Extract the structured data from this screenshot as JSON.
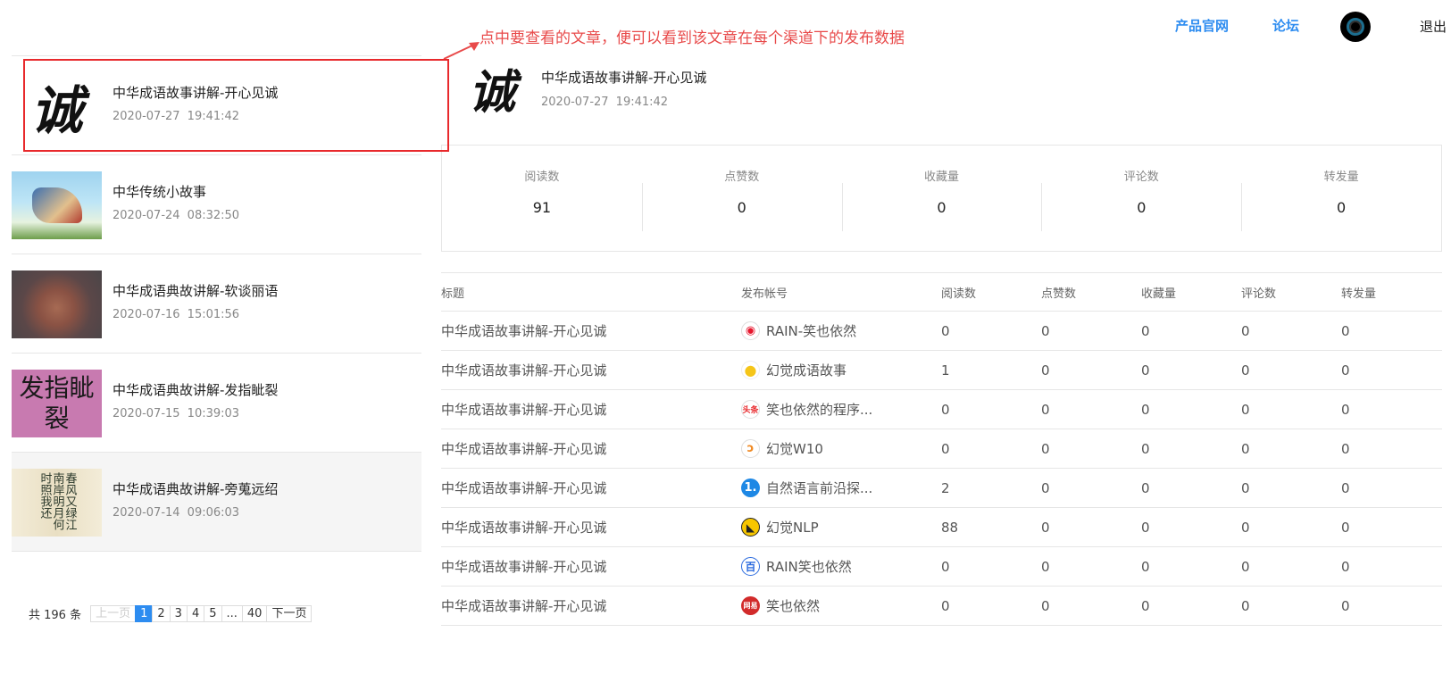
{
  "nav": {
    "product_link": "产品官网",
    "forum_link": "论坛",
    "logout": "退出"
  },
  "annotation": {
    "text": "点中要查看的文章，便可以看到该文章在每个渠道下的发布数据"
  },
  "articles": [
    {
      "title": "中华成语故事讲解-开心见诚",
      "date": "2020-07-27   19:41:42",
      "thumb_text": "诚"
    },
    {
      "title": "中华传统小故事",
      "date": "2020-07-24   08:32:50"
    },
    {
      "title": "中华成语典故讲解-软谈丽语",
      "date": "2020-07-16   15:01:56"
    },
    {
      "title": "中华成语典故讲解-发指眦裂",
      "date": "2020-07-15   10:39:03",
      "thumb_text": "发指眦裂"
    },
    {
      "title": "中华成语典故讲解-旁蒐远绍",
      "date": "2020-07-14   09:06:03",
      "thumb_text": "春风又绿江南岸明月何时照我还"
    }
  ],
  "pagination": {
    "total": "共 196 条",
    "prev": "上一页",
    "pages": [
      "1",
      "2",
      "3",
      "4",
      "5",
      "...",
      "40"
    ],
    "next": "下一页",
    "current": "1"
  },
  "detail": {
    "thumb_text": "诚",
    "title": "中华成语故事讲解-开心见诚",
    "date": "2020-07-27   19:41:42"
  },
  "stats": [
    {
      "label": "阅读数",
      "value": "91"
    },
    {
      "label": "点赞数",
      "value": "0"
    },
    {
      "label": "收藏量",
      "value": "0"
    },
    {
      "label": "评论数",
      "value": "0"
    },
    {
      "label": "转发量",
      "value": "0"
    }
  ],
  "table": {
    "headers": [
      "标题",
      "发布帐号",
      "阅读数",
      "点赞数",
      "收藏量",
      "评论数",
      "转发量"
    ],
    "rows": [
      {
        "title": "中华成语故事讲解-开心见诚",
        "icon": "weibo-icon",
        "icon_glyph": "◉",
        "account": "RAIN-笑也依然",
        "reads": "0",
        "likes": "0",
        "favs": "0",
        "comments": "0",
        "shares": "0"
      },
      {
        "title": "中华成语故事讲解-开心见诚",
        "icon": "qq-icon",
        "icon_glyph": "●",
        "account": "幻觉成语故事",
        "reads": "1",
        "likes": "0",
        "favs": "0",
        "comments": "0",
        "shares": "0"
      },
      {
        "title": "中华成语故事讲解-开心见诚",
        "icon": "toutiao-icon",
        "icon_glyph": "头条",
        "account": "笑也依然的程序...",
        "reads": "0",
        "likes": "0",
        "favs": "0",
        "comments": "0",
        "shares": "0"
      },
      {
        "title": "中华成语故事讲解-开心见诚",
        "icon": "sohu-icon",
        "icon_glyph": "ↄ",
        "account": "幻觉W10",
        "reads": "0",
        "likes": "0",
        "favs": "0",
        "comments": "0",
        "shares": "0"
      },
      {
        "title": "中华成语故事讲解-开心见诚",
        "icon": "yidian-icon",
        "icon_glyph": "1.",
        "account": "自然语言前沿探...",
        "reads": "2",
        "likes": "0",
        "favs": "0",
        "comments": "0",
        "shares": "0"
      },
      {
        "title": "中华成语故事讲解-开心见诚",
        "icon": "dayu-icon",
        "icon_glyph": "◣",
        "account": "幻觉NLP",
        "reads": "88",
        "likes": "0",
        "favs": "0",
        "comments": "0",
        "shares": "0"
      },
      {
        "title": "中华成语故事讲解-开心见诚",
        "icon": "baijia-icon",
        "icon_glyph": "百",
        "account": "RAIN笑也依然",
        "reads": "0",
        "likes": "0",
        "favs": "0",
        "comments": "0",
        "shares": "0"
      },
      {
        "title": "中华成语故事讲解-开心见诚",
        "icon": "wangyi-icon",
        "icon_glyph": "网易",
        "account": "笑也依然",
        "reads": "0",
        "likes": "0",
        "favs": "0",
        "comments": "0",
        "shares": "0"
      }
    ]
  },
  "colors": {
    "accent": "#2d8cf0",
    "annotation": "#e84a4a",
    "highlight_border": "#e8292c"
  }
}
